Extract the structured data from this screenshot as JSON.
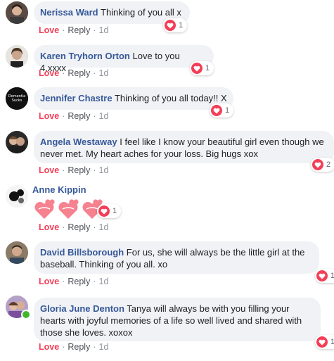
{
  "actions": {
    "love": "Love",
    "reply": "Reply",
    "separator": "·"
  },
  "comments": [
    {
      "author": "Nerissa Ward",
      "text": "Thinking of you all x",
      "time": "1d",
      "reactions": "1"
    },
    {
      "author": "Karen Tryhorn Orton",
      "text": "Love to you 4.xxxx",
      "time": "1d",
      "reactions": "1"
    },
    {
      "author": "Jennifer Chastre",
      "text": "Thinking of you all today!! X",
      "time": "1d",
      "reactions": "1",
      "avatar_text": "Dementia Sucks"
    },
    {
      "author": "Angela Westaway",
      "text": "I feel like I know your beautiful girl even though we never met. My heart aches for your loss. Big hugs xox",
      "time": "1d",
      "reactions": "2"
    },
    {
      "author": "Anne Kippin",
      "text": "",
      "time": "1d",
      "reactions": "1",
      "sticker": "hearts-sticker"
    },
    {
      "author": "David Billsborough",
      "text": "For us, she will always be the little girl at the baseball. Thinking of you all. xo",
      "time": "1d",
      "reactions": "1"
    },
    {
      "author": "Gloria June Denton",
      "text": "Tanya will always be with you filling your hearts with joyful memories of a life so well lived and shared with those she loves. xoxox",
      "time": "1d",
      "reactions": "1"
    }
  ],
  "colors": {
    "author": "#365899",
    "love": "#f33e58",
    "bubble": "#f0f2f5",
    "meta": "#90949c",
    "online": "#42b72a"
  }
}
